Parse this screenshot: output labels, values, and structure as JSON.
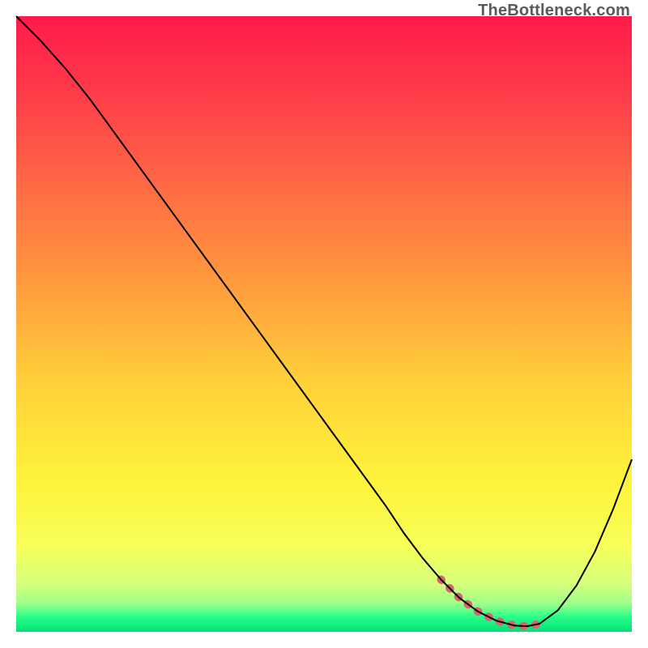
{
  "watermark": "TheBottleneck.com",
  "chart_data": {
    "type": "line",
    "title": "",
    "xlabel": "",
    "ylabel": "",
    "xlim": [
      0,
      100
    ],
    "ylim": [
      0,
      100
    ],
    "gradient_stops": [
      {
        "offset": 0.0,
        "color": "#ff1a4b"
      },
      {
        "offset": 0.12,
        "color": "#ff3a4a"
      },
      {
        "offset": 0.28,
        "color": "#ff6b45"
      },
      {
        "offset": 0.45,
        "color": "#ffa03c"
      },
      {
        "offset": 0.6,
        "color": "#ffd23a"
      },
      {
        "offset": 0.75,
        "color": "#fff23a"
      },
      {
        "offset": 0.86,
        "color": "#f7ff58"
      },
      {
        "offset": 0.92,
        "color": "#d8ff7a"
      },
      {
        "offset": 0.955,
        "color": "#9CFF88"
      },
      {
        "offset": 0.975,
        "color": "#2bff88"
      },
      {
        "offset": 1.0,
        "color": "#00e07a"
      }
    ],
    "series": [
      {
        "name": "bottleneck-curve",
        "color": "#000000",
        "width": 2,
        "x": [
          0,
          4,
          8,
          12,
          16,
          20,
          24,
          28,
          32,
          36,
          40,
          44,
          48,
          52,
          56,
          60,
          63,
          66,
          69,
          72,
          75,
          78,
          81,
          83,
          85,
          88,
          91,
          94,
          97,
          100
        ],
        "y": [
          100,
          96,
          91.5,
          86.5,
          81,
          75.5,
          70,
          64.5,
          59,
          53.5,
          48,
          42.5,
          37,
          31.5,
          26,
          20.5,
          16,
          12,
          8.5,
          5.5,
          3.3,
          1.8,
          1.0,
          0.9,
          1.3,
          3.5,
          7.5,
          13,
          20,
          28
        ]
      },
      {
        "name": "optimal-range-highlight",
        "color": "#d9646e",
        "width": 10,
        "linecap": "round",
        "x": [
          63,
          66,
          69,
          72,
          75,
          78,
          81,
          83,
          85
        ],
        "y": [
          16,
          12,
          8.5,
          5.5,
          3.3,
          1.8,
          1.0,
          0.9,
          1.3
        ]
      }
    ],
    "highlight_visible_segment": {
      "x_start": 69,
      "x_end": 85
    }
  }
}
